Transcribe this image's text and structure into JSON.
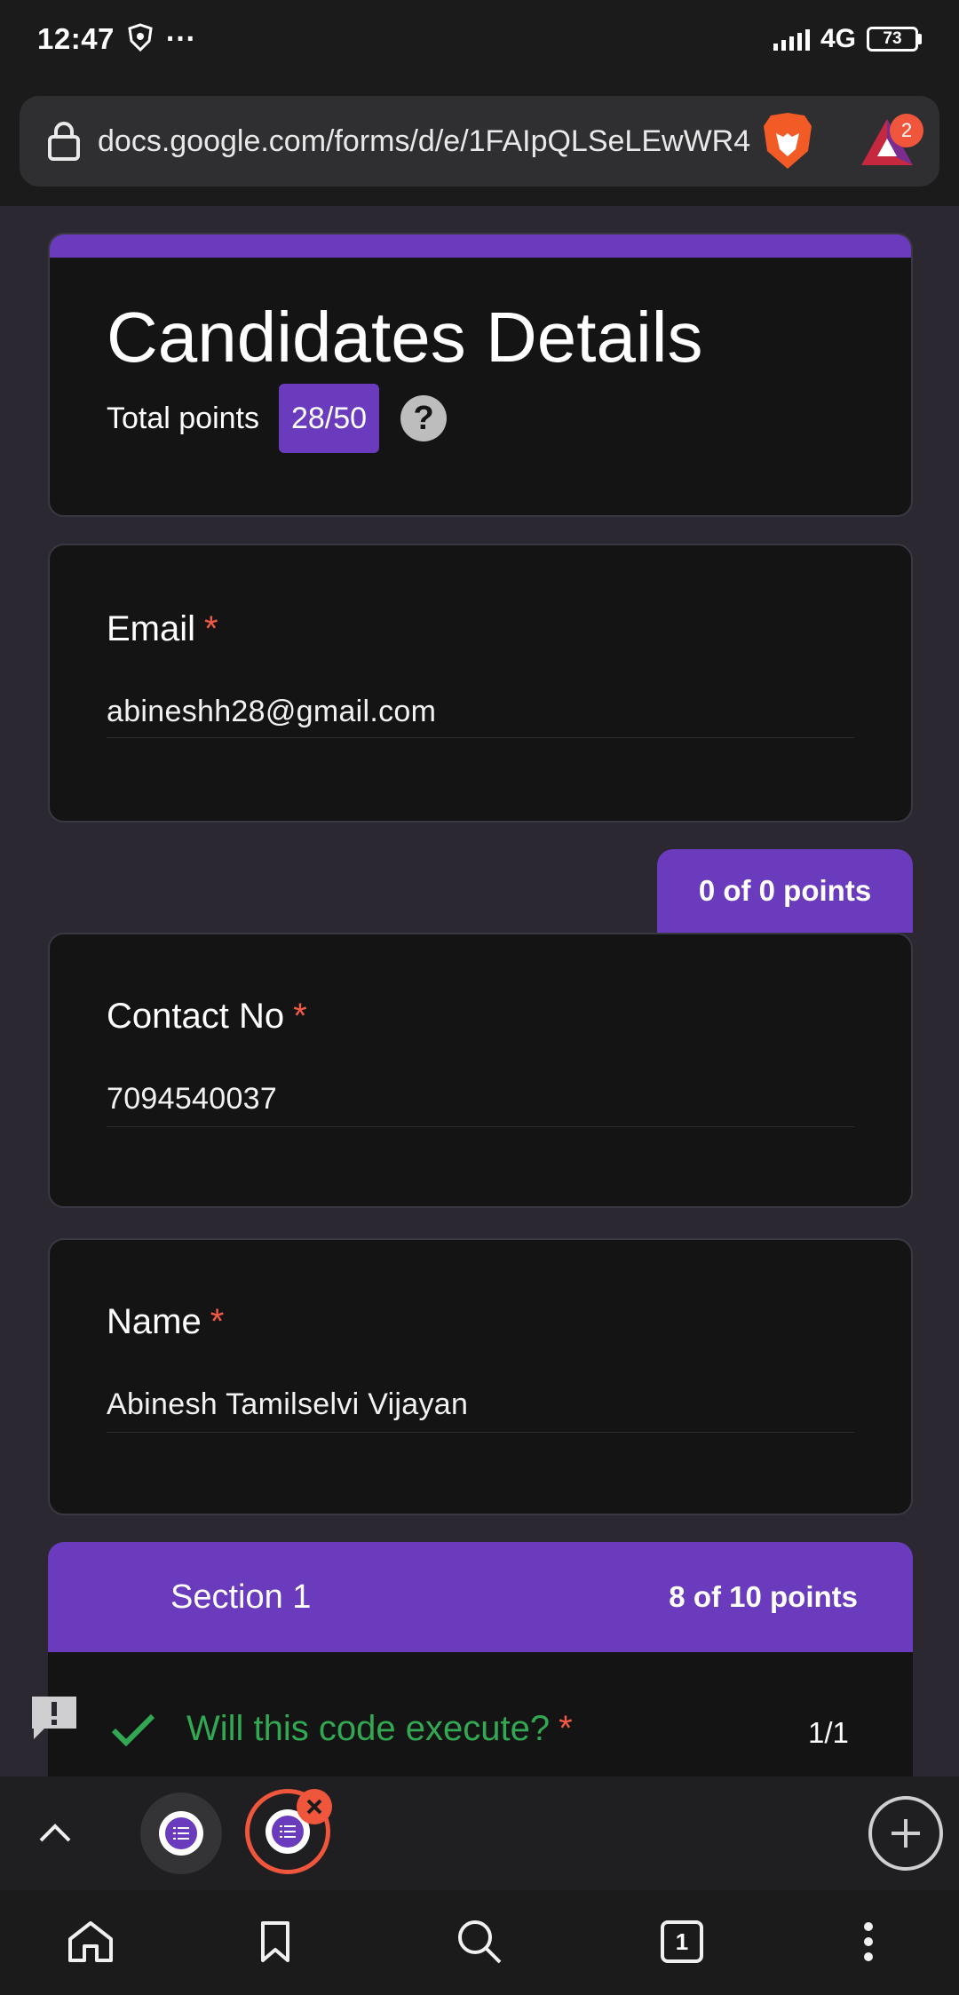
{
  "status_bar": {
    "time": "12:47",
    "more": "···",
    "network": "4G",
    "battery": "73"
  },
  "browser": {
    "url": "docs.google.com/forms/d/e/1FAIpQLSeLEwWR4",
    "notification_count": "2"
  },
  "form": {
    "title": "Candidates Details",
    "total_points_label": "Total points",
    "total_points_value": "28/50",
    "help_symbol": "?",
    "required_marker": "*",
    "accent_color": "#6a3bbd",
    "questions": [
      {
        "label": "Email",
        "answer": "abineshh28@gmail.com"
      },
      {
        "label": "Contact No",
        "answer": "7094540037"
      },
      {
        "label": "Name",
        "answer": "Abinesh Tamilselvi Vijayan"
      }
    ],
    "points_tab": "0 of 0 points",
    "section": {
      "title": "Section 1",
      "points": "8 of 10 points",
      "first_question": "Will this code execute?",
      "first_question_score": "1/1"
    }
  },
  "tab_strip": {
    "open_tabs": 2
  },
  "nav": {
    "tab_count": "1"
  }
}
